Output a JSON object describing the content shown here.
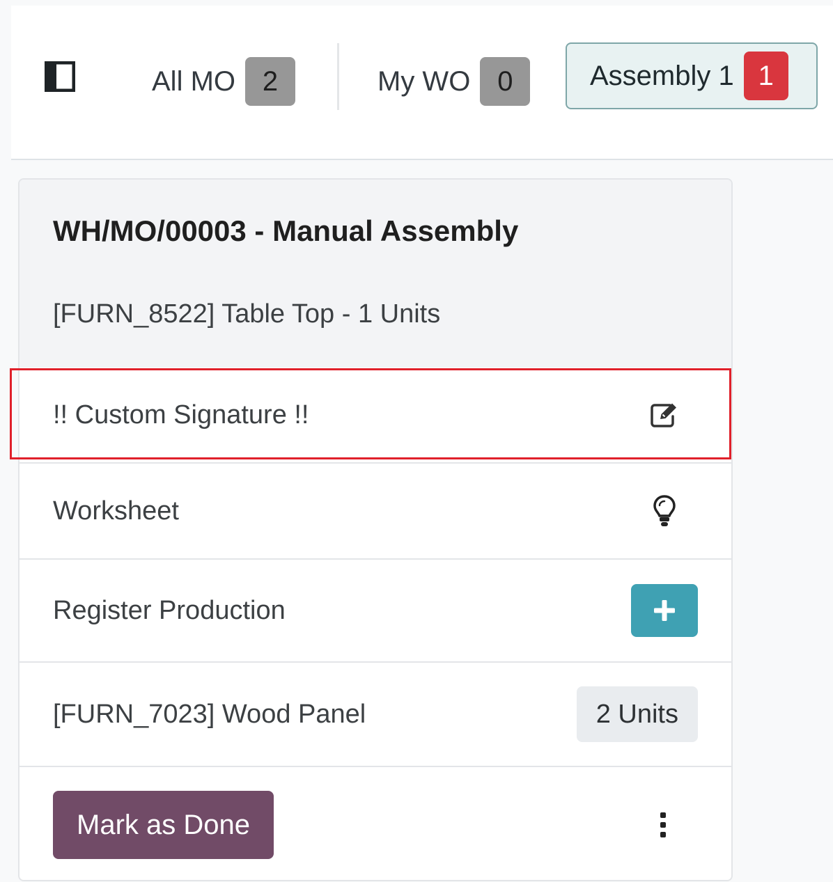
{
  "colors": {
    "accent_teal": "#3fa1b3",
    "primary_purple": "#714b67",
    "alert_red": "#d9363e",
    "highlight_red": "#e0202a",
    "badge_gray": "#979797"
  },
  "topbar": {
    "sidebar_toggle_icon": "sidebar-toggle-icon",
    "tabs": [
      {
        "label": "All MO",
        "count": "2",
        "active": false
      },
      {
        "label": "My WO",
        "count": "0",
        "active": false
      },
      {
        "label": "Assembly 1",
        "count": "1",
        "active": true
      }
    ]
  },
  "card": {
    "title": "WH/MO/00003 - Manual Assembly",
    "subtitle": "[FURN_8522] Table Top - 1 Units",
    "steps": {
      "signature": {
        "label": "!! Custom Signature !!",
        "icon": "edit-icon"
      },
      "worksheet": {
        "label": "Worksheet",
        "icon": "lightbulb-icon"
      },
      "register": {
        "label": "Register Production",
        "icon": "plus-icon"
      }
    },
    "component": {
      "label": "[FURN_7023] Wood Panel",
      "quantity": "2 Units"
    },
    "footer": {
      "done_label": "Mark as Done",
      "menu_icon": "kebab-menu-icon"
    }
  }
}
